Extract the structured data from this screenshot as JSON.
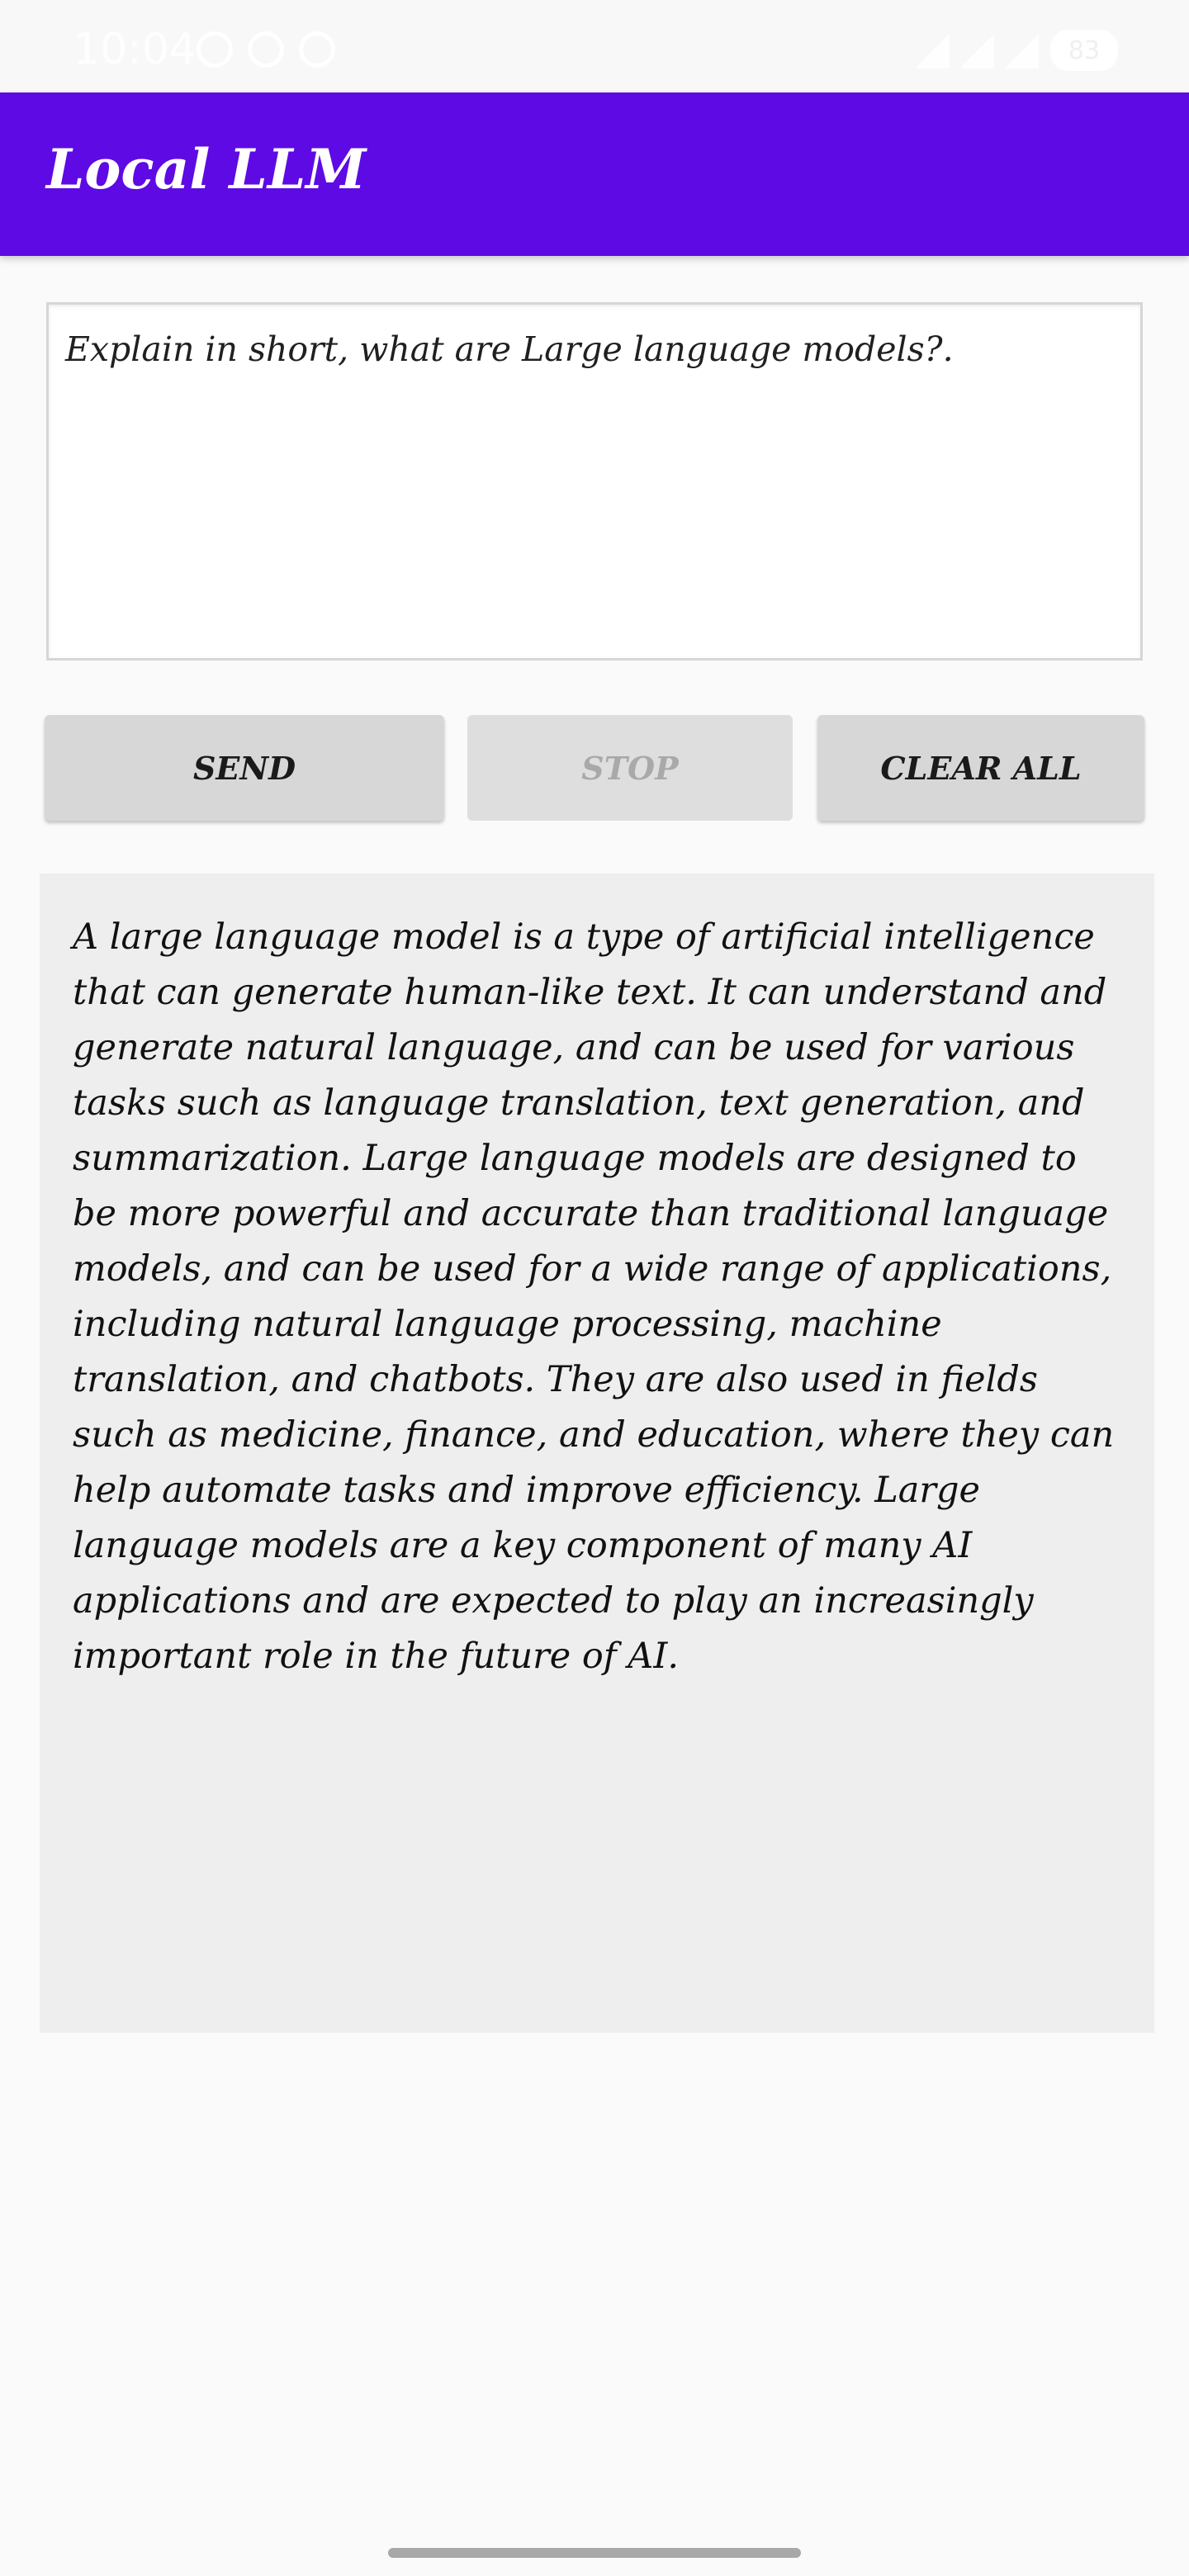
{
  "status_bar": {
    "time": "10:04",
    "battery": "83"
  },
  "app_bar": {
    "title": "Local LLM"
  },
  "prompt": {
    "value": "Explain in short, what are Large language models?."
  },
  "buttons": {
    "send": "SEND",
    "stop": "STOP",
    "clear_all": "CLEAR ALL"
  },
  "response": {
    "text": "A large language model is a type of artificial intelligence that can generate human-like text. It can understand and generate natural language, and can be used for various tasks such as language translation, text generation, and summarization. Large language models are designed to be more powerful and accurate than traditional language models, and can be used for a wide range of applications, including natural language processing, machine translation, and chatbots. They are also used in fields such as medicine, finance, and education, where they can help automate tasks and improve efficiency. Large language models are a key component of many AI applications and are expected to play an increasingly important role in the future of AI."
  },
  "colors": {
    "app_bar": "#5e0ae4",
    "button_bg": "#d7d7d7",
    "response_bg": "#eeeeee",
    "page_bg": "#fafafa"
  }
}
